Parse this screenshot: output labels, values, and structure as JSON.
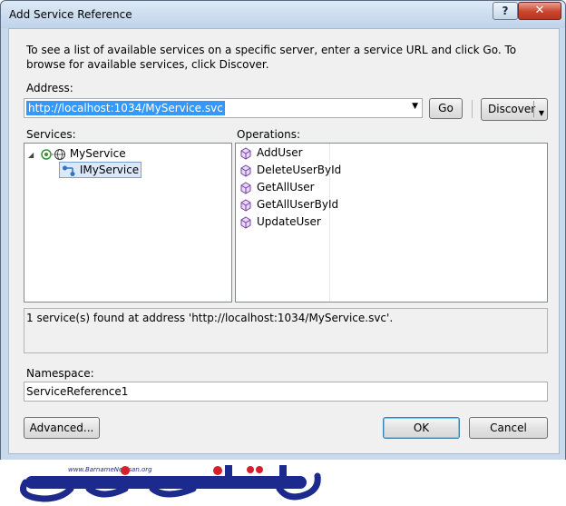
{
  "window": {
    "title": "Add Service Reference",
    "help_label": "?",
    "close_label": "✕"
  },
  "instructions": "To see a list of available services on a specific server, enter a service URL and click Go. To browse for available services, click Discover.",
  "address": {
    "label": "Address:",
    "value": "http://localhost:1034/MyService.svc",
    "go_label": "Go",
    "discover_label": "Discover"
  },
  "services": {
    "label": "Services:",
    "tree": [
      {
        "label": "MyService",
        "icon": "service-globe-icon",
        "expanded": true
      },
      {
        "label": "IMyService",
        "icon": "interface-icon",
        "selected": true
      }
    ]
  },
  "operations": {
    "label": "Operations:",
    "items": [
      "AddUser",
      "DeleteUserById",
      "GetAllUser",
      "GetAllUserById",
      "UpdateUser"
    ],
    "icon": "operation-cube-icon"
  },
  "status_text": "1 service(s) found at address 'http://localhost:1034/MyService.svc'.",
  "namespace": {
    "label": "Namespace:",
    "value": "ServiceReference1"
  },
  "buttons": {
    "advanced": "Advanced...",
    "ok": "OK",
    "cancel": "Cancel"
  },
  "watermark": {
    "url": "www.BarnameNevisan.org",
    "logo_text": "برنامه نویسان"
  },
  "colors": {
    "selection": "#3399ff",
    "logo_blue": "#1b2a8c",
    "logo_red": "#d5202b"
  }
}
